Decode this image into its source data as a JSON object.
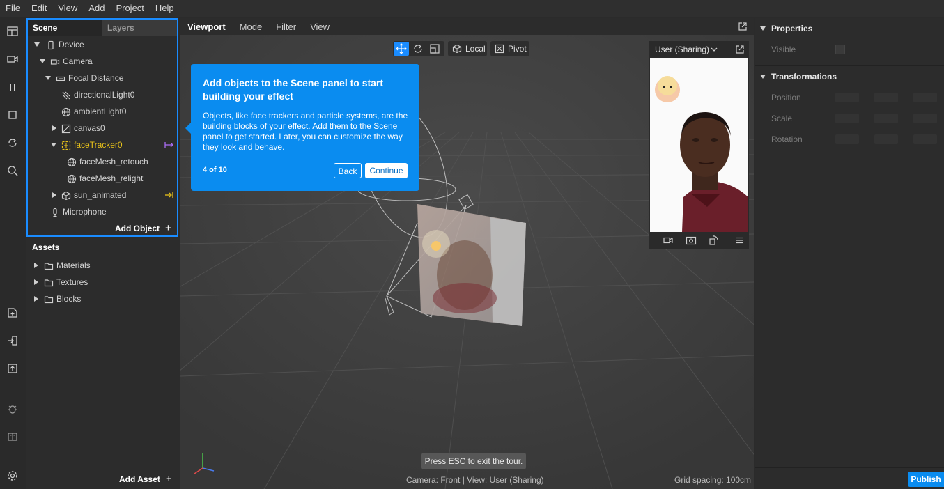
{
  "menubar": [
    "File",
    "Edit",
    "View",
    "Add",
    "Project",
    "Help"
  ],
  "scene": {
    "tabs": [
      "Scene",
      "Layers"
    ],
    "tree": [
      {
        "label": "Device",
        "icon": "device-icon",
        "caret": "down"
      },
      {
        "label": "Camera",
        "icon": "camera-icon",
        "caret": "down"
      },
      {
        "label": "Focal Distance",
        "icon": "focal-distance-icon",
        "caret": "down"
      },
      {
        "label": "directionalLight0",
        "icon": "directional-light-icon",
        "caret": ""
      },
      {
        "label": "ambientLight0",
        "icon": "ambient-light-icon",
        "caret": ""
      },
      {
        "label": "canvas0",
        "icon": "canvas-icon",
        "caret": "right"
      },
      {
        "label": "faceTracker0",
        "icon": "face-tracker-icon",
        "caret": "down"
      },
      {
        "label": "faceMesh_retouch",
        "icon": "face-mesh-icon",
        "caret": ""
      },
      {
        "label": "faceMesh_relight",
        "icon": "face-mesh-icon",
        "caret": ""
      },
      {
        "label": "sun_animated",
        "icon": "3d-object-icon",
        "caret": "right"
      },
      {
        "label": "Microphone",
        "icon": "microphone-icon",
        "caret": ""
      }
    ],
    "add_object": "Add Object"
  },
  "assets": {
    "title": "Assets",
    "items": [
      "Materials",
      "Textures",
      "Blocks"
    ],
    "add_asset": "Add Asset"
  },
  "viewport": {
    "tabs": [
      "Viewport",
      "Mode",
      "Filter",
      "View"
    ],
    "toolbar": {
      "local": "Local",
      "pivot": "Pivot"
    },
    "esc_hint": "Press ESC to exit the tour.",
    "status": "Camera: Front | View: User (Sharing)",
    "grid_spacing": "Grid spacing: 100cm"
  },
  "preview": {
    "dropdown": "User (Sharing)"
  },
  "tour": {
    "title": "Add objects to the Scene panel to start building your effect",
    "body": "Objects, like face trackers and particle systems, are the building blocks of your effect. Add them to the Scene panel to get started. Later, you can customize the way they look and behave.",
    "step": "4 of 10",
    "back": "Back",
    "continue": "Continue"
  },
  "properties": {
    "title": "Properties",
    "visible": "Visible",
    "transformations": "Transformations",
    "position": "Position",
    "scale": "Scale",
    "rotation": "Rotation",
    "publish": "Publish"
  },
  "colors": {
    "accent": "#0a8cf0",
    "face_tracker": "#e8c21a",
    "link_purple": "#a86cf0",
    "link_yellow": "#e8c21a"
  }
}
